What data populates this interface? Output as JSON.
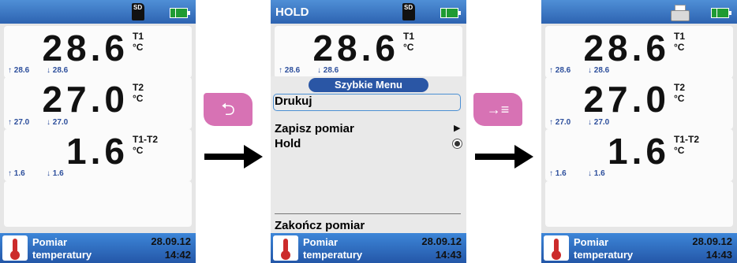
{
  "screens": [
    {
      "topbar": {
        "sd_label": "SD"
      },
      "measurements": [
        {
          "value": "28.6",
          "label": "T1",
          "unit": "°C",
          "max": "28.6",
          "min": "28.6"
        },
        {
          "value": "27.0",
          "label": "T2",
          "unit": "°C",
          "max": "27.0",
          "min": "27.0"
        },
        {
          "value": "1.6",
          "label": "T1-T2",
          "unit": "°C",
          "max": "1.6",
          "min": "1.6"
        }
      ],
      "bottom": {
        "name_line1": "Pomiar",
        "name_line2": "temperatury",
        "date": "28.09.12",
        "time": "14:42"
      }
    },
    {
      "topbar": {
        "title": "HOLD",
        "sd_label": "SD"
      },
      "measurements": [
        {
          "value": "28.6",
          "label": "T1",
          "unit": "°C",
          "max": "28.6",
          "min": "28.6"
        }
      ],
      "menu": {
        "title": "Szybkie Menu",
        "items": [
          "Drukuj",
          "Zapisz pomiar",
          "Hold",
          "Zakończ pomiar"
        ]
      },
      "bottom": {
        "name_line1": "Pomiar",
        "name_line2": "temperatury",
        "date": "28.09.12",
        "time": "14:43"
      }
    },
    {
      "topbar": {},
      "measurements": [
        {
          "value": "28.6",
          "label": "T1",
          "unit": "°C",
          "max": "28.6",
          "min": "28.6"
        },
        {
          "value": "27.0",
          "label": "T2",
          "unit": "°C",
          "max": "27.0",
          "min": "27.0"
        },
        {
          "value": "1.6",
          "label": "T1-T2",
          "unit": "°C",
          "max": "1.6",
          "min": "1.6"
        }
      ],
      "bottom": {
        "name_line1": "Pomiar",
        "name_line2": "temperatury",
        "date": "28.09.12",
        "time": "14:43"
      }
    }
  ],
  "keys": {
    "back_glyph": "⮌",
    "next_glyph": "→≡"
  },
  "icons": {
    "max_arrow": "↑",
    "min_arrow": "↓"
  },
  "colors": {
    "accent": "#2d63b1",
    "key": "#d772b4",
    "battery": "#1f9b33"
  }
}
